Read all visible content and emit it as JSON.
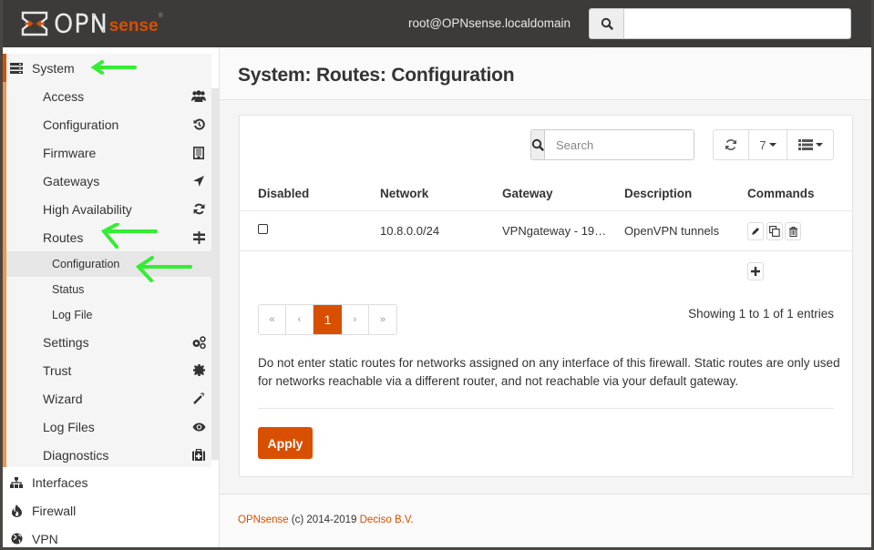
{
  "header": {
    "logo_opn": "OPN",
    "logo_sense": "sense",
    "logo_reg": "®",
    "user": "root@OPNsense.localdomain",
    "search_placeholder": "",
    "search_icon": "search-icon"
  },
  "sidebar": {
    "system": {
      "label": "System",
      "icon": "server-icon"
    },
    "items": [
      {
        "label": "Access",
        "icon": "users-icon"
      },
      {
        "label": "Configuration",
        "icon": "history-icon"
      },
      {
        "label": "Firmware",
        "icon": "building-icon"
      },
      {
        "label": "Gateways",
        "icon": "location-arrow-icon"
      },
      {
        "label": "High Availability",
        "icon": "refresh-icon"
      },
      {
        "label": "Routes",
        "icon": "signpost-icon"
      }
    ],
    "routes_sub": [
      {
        "label": "Configuration",
        "active": true
      },
      {
        "label": "Status",
        "active": false
      },
      {
        "label": "Log File",
        "active": false
      }
    ],
    "items_after": [
      {
        "label": "Settings",
        "icon": "cogs-icon"
      },
      {
        "label": "Trust",
        "icon": "certificate-icon"
      },
      {
        "label": "Wizard",
        "icon": "magic-icon"
      },
      {
        "label": "Log Files",
        "icon": "eye-icon"
      },
      {
        "label": "Diagnostics",
        "icon": "medkit-icon"
      }
    ],
    "sections": [
      {
        "label": "Interfaces",
        "icon": "sitemap-icon"
      },
      {
        "label": "Firewall",
        "icon": "fire-icon"
      },
      {
        "label": "VPN",
        "icon": "globe-icon"
      }
    ]
  },
  "main": {
    "title": "System: Routes: Configuration",
    "grid": {
      "search_placeholder": "Search",
      "row_count": "7",
      "columns": [
        "Disabled",
        "Network",
        "Gateway",
        "Description",
        "Commands"
      ],
      "rows": [
        {
          "disabled": false,
          "network": "10.8.0.0/24",
          "gateway": "VPNgateway - 19…",
          "description": "OpenVPN tunnels"
        }
      ],
      "pager": {
        "first": "«",
        "prev": "‹",
        "current": "1",
        "next": "›",
        "last": "»"
      },
      "showing": "Showing 1 to 1 of 1 entries"
    },
    "note": "Do not enter static routes for networks assigned on any interface of this firewall. Static routes are only used for networks reachable via a different router, and not reachable via your default gateway.",
    "apply_label": "Apply"
  },
  "footer": {
    "brand": "OPNsense",
    "copyright": " (c) 2014-2019 ",
    "company": "Deciso B.V."
  },
  "colors": {
    "accent": "#d94f00",
    "header_bg": "#3c3b39",
    "annotation_arrow": "#33ee33"
  }
}
